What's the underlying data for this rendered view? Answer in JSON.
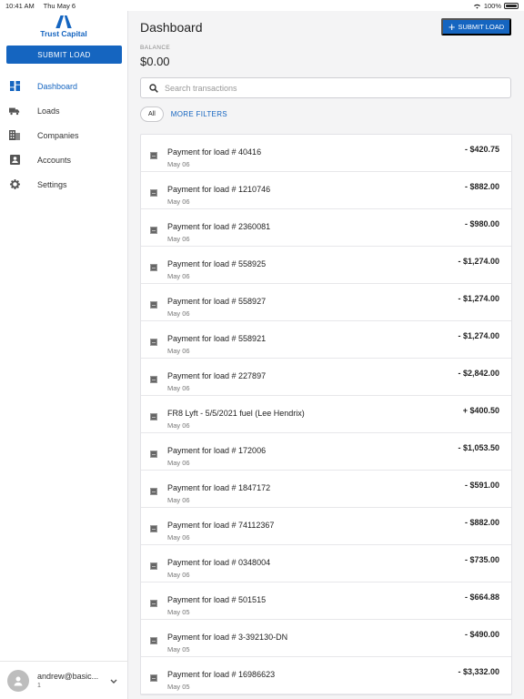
{
  "status": {
    "time": "10:41 AM",
    "date": "Thu May 6",
    "battery": "100%"
  },
  "sidebar": {
    "brand": "Trust Capital",
    "submit_label": "SUBMIT LOAD",
    "items": [
      {
        "label": "Dashboard",
        "icon": "dashboard-icon",
        "active": true
      },
      {
        "label": "Loads",
        "icon": "truck-icon"
      },
      {
        "label": "Companies",
        "icon": "building-icon"
      },
      {
        "label": "Accounts",
        "icon": "account-icon"
      },
      {
        "label": "Settings",
        "icon": "gear-icon"
      }
    ],
    "user": {
      "email": "andrew@basic...",
      "sub": "1"
    }
  },
  "header": {
    "title": "Dashboard",
    "submit_label": "SUBMIT LOAD"
  },
  "balance": {
    "label": "BALANCE",
    "value": "$0.00"
  },
  "search": {
    "placeholder": "Search transactions"
  },
  "filters": {
    "chip": "All",
    "more": "MORE FILTERS"
  },
  "transactions": [
    {
      "title": "Payment for load # 40416",
      "date": "May 06",
      "amount": "- $420.75"
    },
    {
      "title": "Payment for load # 1210746",
      "date": "May 06",
      "amount": "- $882.00"
    },
    {
      "title": "Payment for load # 2360081",
      "date": "May 06",
      "amount": "- $980.00"
    },
    {
      "title": "Payment for load # 558925",
      "date": "May 06",
      "amount": "- $1,274.00"
    },
    {
      "title": "Payment for load # 558927",
      "date": "May 06",
      "amount": "- $1,274.00"
    },
    {
      "title": "Payment for load # 558921",
      "date": "May 06",
      "amount": "- $1,274.00"
    },
    {
      "title": "Payment for load # 227897",
      "date": "May 06",
      "amount": "- $2,842.00"
    },
    {
      "title": "FR8 Lyft - 5/5/2021 fuel (Lee Hendrix)",
      "date": "May 06",
      "amount": "+ $400.50"
    },
    {
      "title": "Payment for load # 172006",
      "date": "May 06",
      "amount": "- $1,053.50"
    },
    {
      "title": "Payment for load # 1847172",
      "date": "May 06",
      "amount": "- $591.00"
    },
    {
      "title": "Payment for load # 74112367",
      "date": "May 06",
      "amount": "- $882.00"
    },
    {
      "title": "Payment for load # 0348004",
      "date": "May 06",
      "amount": "- $735.00"
    },
    {
      "title": "Payment for load # 501515",
      "date": "May 05",
      "amount": "- $664.88"
    },
    {
      "title": "Payment for load # 3-392130-DN",
      "date": "May 05",
      "amount": "- $490.00"
    },
    {
      "title": "Payment for load # 16986623",
      "date": "May 05",
      "amount": "- $3,332.00"
    }
  ]
}
